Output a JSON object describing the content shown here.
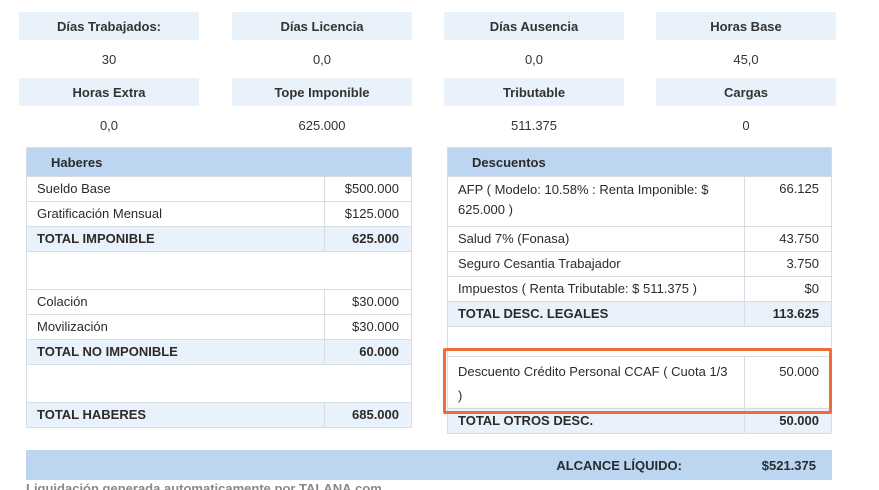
{
  "summary": {
    "dias_trabajados": {
      "label": "Días Trabajados:",
      "value": "30"
    },
    "dias_licencia": {
      "label": "Días Licencia",
      "value": "0,0"
    },
    "dias_ausencia": {
      "label": "Días Ausencia",
      "value": "0,0"
    },
    "horas_base": {
      "label": "Horas Base",
      "value": "45,0"
    },
    "horas_extra": {
      "label": "Horas Extra",
      "value": "0,0"
    },
    "tope_imponible": {
      "label": "Tope Imponible",
      "value": "625.000"
    },
    "tributable": {
      "label": "Tributable",
      "value": "511.375"
    },
    "cargas": {
      "label": "Cargas",
      "value": "0"
    }
  },
  "haberes": {
    "title": "Haberes",
    "sueldo_base": {
      "label": "Sueldo Base",
      "value": "$500.000"
    },
    "gratificacion": {
      "label": "Gratificación Mensual",
      "value": "$125.000"
    },
    "total_imponible": {
      "label": "TOTAL IMPONIBLE",
      "value": "625.000"
    },
    "colacion": {
      "label": "Colación",
      "value": "$30.000"
    },
    "movilizacion": {
      "label": "Movilización",
      "value": "$30.000"
    },
    "total_no_imponible": {
      "label": "TOTAL NO IMPONIBLE",
      "value": "60.000"
    },
    "total_haberes": {
      "label": "TOTAL HABERES",
      "value": "685.000"
    }
  },
  "descuentos": {
    "title": "Descuentos",
    "afp": {
      "label": "AFP ( Modelo: 10.58% : Renta Imponible: $ 625.000 )",
      "value": "66.125"
    },
    "salud": {
      "label": "Salud 7% (Fonasa)",
      "value": "43.750"
    },
    "seguro_cesantia": {
      "label": "Seguro Cesantia Trabajador",
      "value": "3.750"
    },
    "impuestos": {
      "label": "Impuestos ( Renta Tributable: $ 511.375 )",
      "value": "$0"
    },
    "total_legales": {
      "label": "TOTAL DESC. LEGALES",
      "value": "113.625"
    },
    "credito_ccaf": {
      "label": "Descuento Crédito Personal CCAF ( Cuota 1/3 )",
      "value": "50.000"
    },
    "total_otros": {
      "label": "TOTAL OTROS DESC.",
      "value": "50.000"
    }
  },
  "alcance_liquido": {
    "label": "ALCANCE LÍQUIDO:",
    "value": "$521.375"
  },
  "footer": "Liquidación generada automaticamente por TALANA.com",
  "colors": {
    "header_blue": "#bcd6f2",
    "light_blue": "#e9f1fb",
    "highlight": "#f06a3c"
  }
}
